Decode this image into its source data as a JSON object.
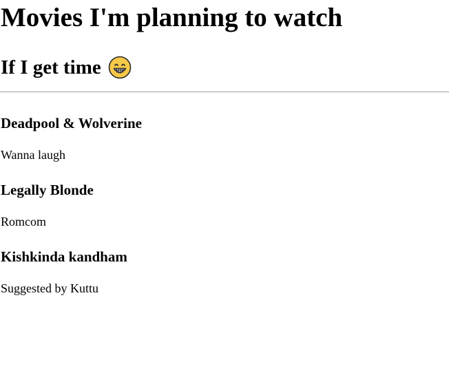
{
  "page": {
    "title": "Movies I'm planning to watch",
    "subtitle": "If I get time",
    "subtitle_icon": "grinning-face-emoji"
  },
  "movies": [
    {
      "title": "Deadpool & Wolverine",
      "note": "Wanna laugh"
    },
    {
      "title": "Legally Blonde",
      "note": "Romcom"
    },
    {
      "title": "Kishkinda kandham",
      "note": "Suggested by Kuttu"
    }
  ],
  "colors": {
    "text": "#000000",
    "divider": "#9a9a9a",
    "emoji_face": "#f7c948",
    "emoji_outline": "#2b2b2b"
  }
}
